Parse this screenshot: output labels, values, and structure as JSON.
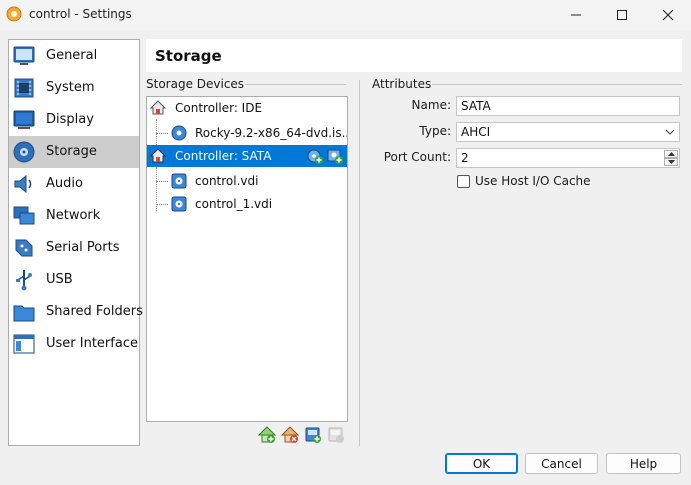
{
  "window": {
    "title": "control - Settings"
  },
  "sidebar": {
    "items": [
      {
        "label": "General",
        "icon": "general-icon"
      },
      {
        "label": "System",
        "icon": "system-icon"
      },
      {
        "label": "Display",
        "icon": "display-icon"
      },
      {
        "label": "Storage",
        "icon": "storage-icon",
        "selected": true
      },
      {
        "label": "Audio",
        "icon": "audio-icon"
      },
      {
        "label": "Network",
        "icon": "network-icon"
      },
      {
        "label": "Serial Ports",
        "icon": "serial-ports-icon"
      },
      {
        "label": "USB",
        "icon": "usb-icon"
      },
      {
        "label": "Shared Folders",
        "icon": "shared-folders-icon"
      },
      {
        "label": "User Interface",
        "icon": "user-interface-icon"
      }
    ]
  },
  "page": {
    "title": "Storage"
  },
  "storage": {
    "devices_label": "Storage Devices",
    "tree": [
      {
        "label": "Controller: IDE",
        "type": "controller"
      },
      {
        "label": "Rocky-9.2-x86_64-dvd.is...",
        "type": "optical"
      },
      {
        "label": "Controller: SATA",
        "type": "controller",
        "selected": true
      },
      {
        "label": "control.vdi",
        "type": "disk"
      },
      {
        "label": "control_1.vdi",
        "type": "disk"
      }
    ]
  },
  "attributes": {
    "group_label": "Attributes",
    "name_label": "Name:",
    "name_value": "SATA",
    "type_label": "Type:",
    "type_value": "AHCI",
    "port_count_label": "Port Count:",
    "port_count_value": "2",
    "host_cache_label": "Use Host I/O Cache",
    "host_cache_checked": false
  },
  "buttons": {
    "ok": "OK",
    "cancel": "Cancel",
    "help": "Help"
  },
  "colors": {
    "selection": "#0078d7",
    "sidebar_selected": "#cdcdcd",
    "accent_green": "#3aa53a"
  }
}
